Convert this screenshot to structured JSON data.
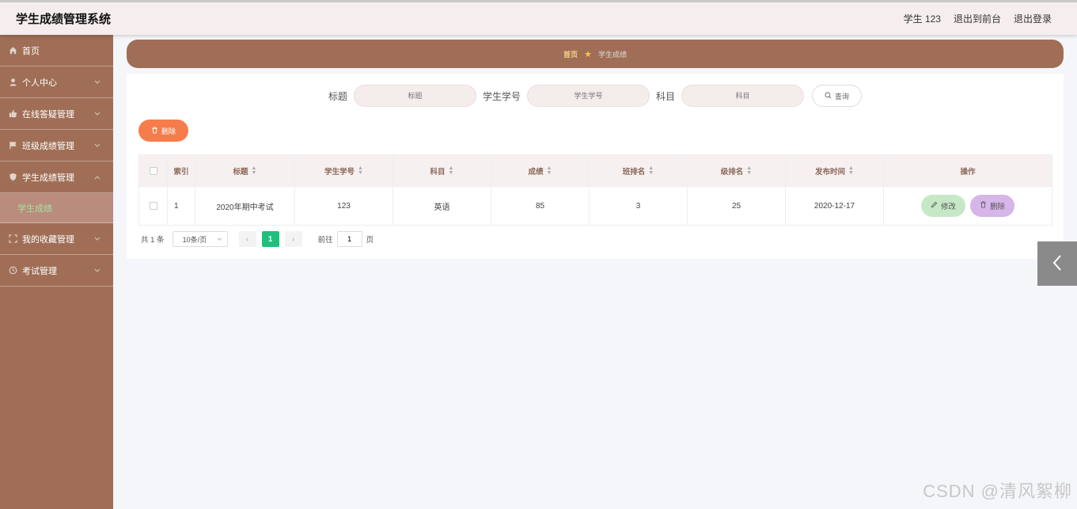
{
  "header": {
    "app_title": "学生成绩管理系统",
    "user": "学生 123",
    "to_front": "退出到前台",
    "logout": "退出登录"
  },
  "sidebar": {
    "items": [
      {
        "label": "首页",
        "icon": "home-icon"
      },
      {
        "label": "个人中心",
        "icon": "user-icon"
      },
      {
        "label": "在线答疑管理",
        "icon": "thumbs-icon"
      },
      {
        "label": "班级成绩管理",
        "icon": "flag-icon"
      },
      {
        "label": "学生成绩管理",
        "icon": "shield-icon"
      },
      {
        "label": "我的收藏管理",
        "icon": "bracket-icon"
      },
      {
        "label": "考试管理",
        "icon": "clock-icon"
      }
    ],
    "active_sub": "学生成绩"
  },
  "breadcrumb": {
    "home": "首页",
    "current": "学生成绩"
  },
  "search": {
    "title_label": "标题",
    "title_placeholder": "标题",
    "student_no_label": "学生学号",
    "student_no_placeholder": "学生学号",
    "subject_label": "科目",
    "subject_placeholder": "科目",
    "query_button": "查询"
  },
  "toolbar": {
    "delete_label": "删除"
  },
  "table": {
    "columns": [
      "索引",
      "标题",
      "学生学号",
      "科目",
      "成绩",
      "班排名",
      "级排名",
      "发布时间",
      "操作"
    ],
    "rows": [
      {
        "index": "1",
        "title": "2020年期中考试",
        "student_no": "123",
        "subject": "英语",
        "score": "85",
        "class_rank": "3",
        "grade_rank": "25",
        "publish_time": "2020-12-17"
      }
    ],
    "edit_label": "修改",
    "delete_label": "删除"
  },
  "pagination": {
    "total": "共 1 条",
    "page_size": "10条/页",
    "current_page": "1",
    "goto_label": "前往",
    "goto_value": "1",
    "page_suffix": "页"
  },
  "watermark": "CSDN @清风絮柳",
  "colors": {
    "sidebar": "#a06e56",
    "accent_orange": "#f67c4c",
    "page_active": "#1ec07c"
  }
}
